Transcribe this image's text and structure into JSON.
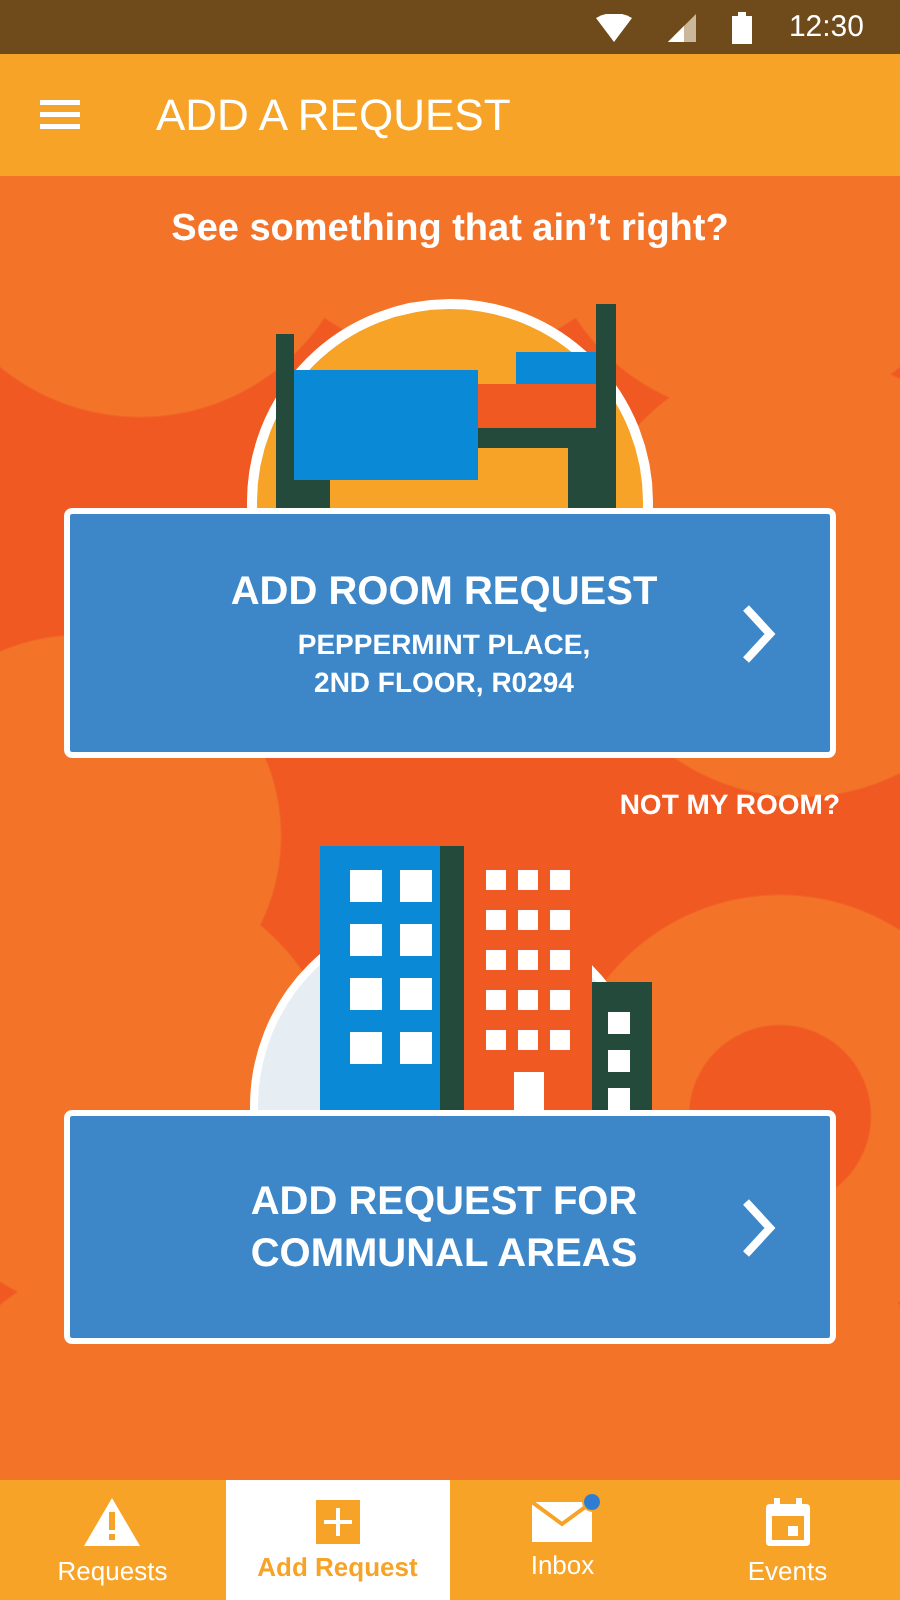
{
  "status_bar": {
    "time": "12:30"
  },
  "app_bar": {
    "title": "ADD A REQUEST"
  },
  "heading": "See something that ain’t right?",
  "room_card": {
    "title": "ADD ROOM REQUEST",
    "subtitle_lines": [
      "PEPPERMINT PLACE,",
      "2ND FLOOR, R0294"
    ]
  },
  "not_my_room_link": "NOT MY ROOM?",
  "communal_card": {
    "title_lines": [
      "ADD REQUEST FOR",
      "COMMUNAL AREAS"
    ]
  },
  "bottom_nav": [
    {
      "label": "Requests",
      "selected": false,
      "unread": false
    },
    {
      "label": "Add Request",
      "selected": true,
      "unread": false
    },
    {
      "label": "Inbox",
      "selected": false,
      "unread": true
    },
    {
      "label": "Events",
      "selected": false,
      "unread": false
    }
  ]
}
